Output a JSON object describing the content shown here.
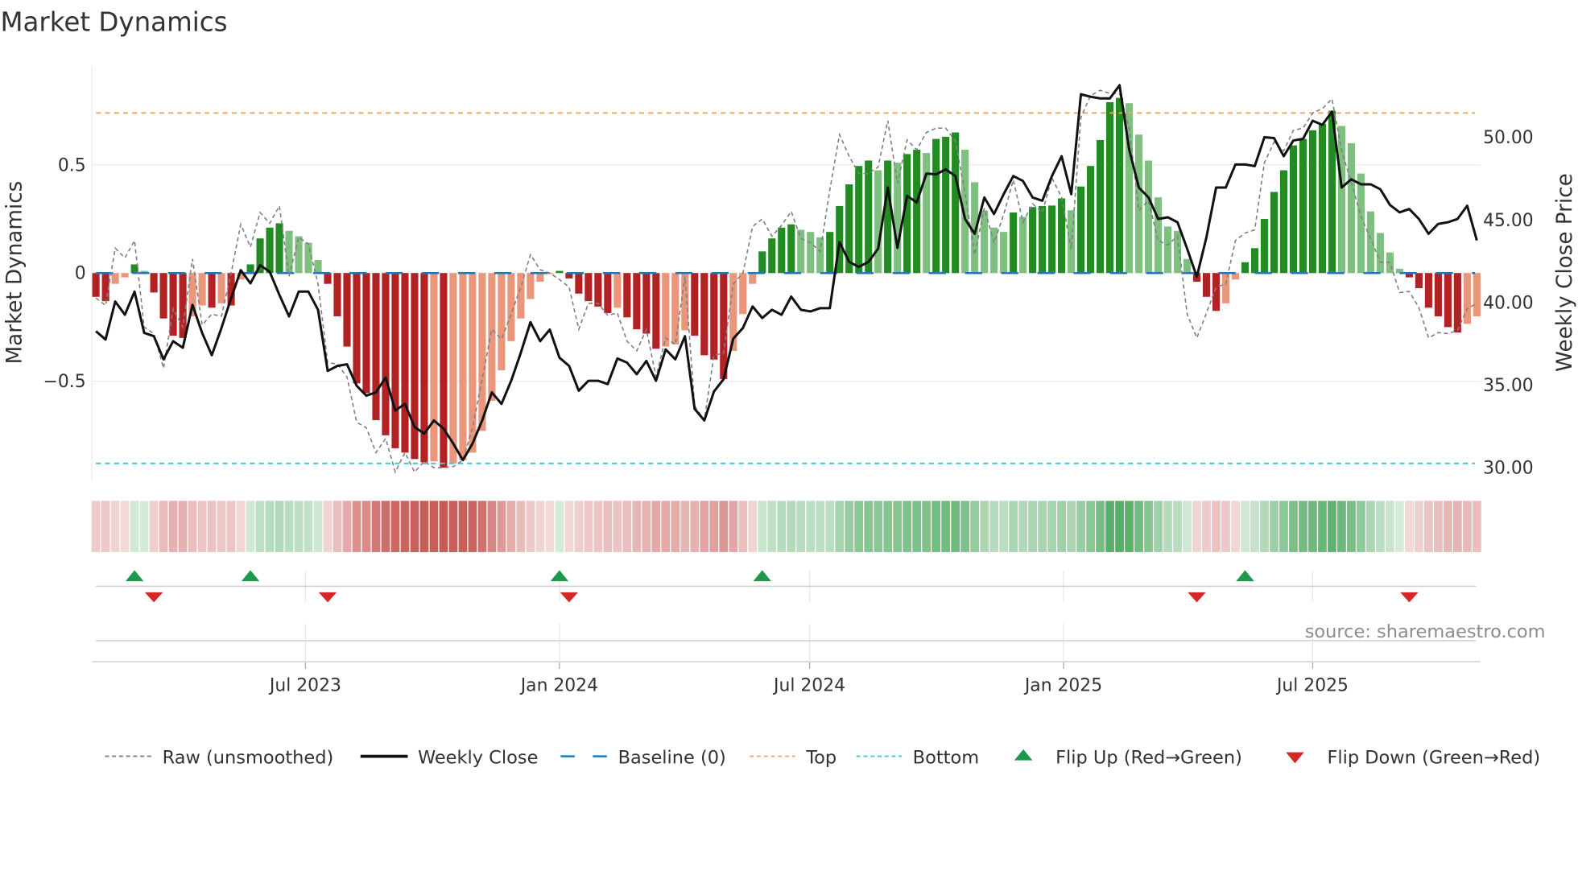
{
  "title": "Market Dynamics",
  "source": "source: sharemaestro.com",
  "colors": {
    "bar_up_strong": "#228b22",
    "bar_up_weak": "#7fbf7f",
    "bar_down_strong": "#b22222",
    "bar_down_weak": "#e9967a",
    "close_line": "#111111",
    "raw_line": "#808080",
    "baseline": "#1f77b4",
    "top": "#f0a868",
    "bottom": "#3cc8dc",
    "flip_up": "#1a9a4a",
    "flip_down": "#d62728",
    "heat_green": "#48a85a",
    "heat_red": "#c85a55"
  },
  "chart_data": {
    "type": "bar",
    "title": "Market Dynamics",
    "xlabel": "",
    "ylabel": "Market Dynamics",
    "ylabel_right": "Weekly Close Price",
    "ylim": [
      -0.96,
      0.96
    ],
    "ylim_right": [
      29.15,
      54.3
    ],
    "yticks": [
      {
        "value": 0.5,
        "label": "0.5"
      },
      {
        "value": 0,
        "label": "0"
      },
      {
        "value": -0.5,
        "label": "−0.5"
      }
    ],
    "yticks_right": [
      {
        "value": 50,
        "label": "50.00"
      },
      {
        "value": 45,
        "label": "45.00"
      },
      {
        "value": 40,
        "label": "40.00"
      },
      {
        "value": 35,
        "label": "35.00"
      },
      {
        "value": 30,
        "label": "30.00"
      }
    ],
    "x_unit": "week index",
    "xticks": [
      {
        "week": 21.7,
        "label": "Jul 2023"
      },
      {
        "week": 48.0,
        "label": "Jan 2024"
      },
      {
        "week": 73.9,
        "label": "Jul 2024"
      },
      {
        "week": 100.2,
        "label": "Jan 2025"
      },
      {
        "week": 126.0,
        "label": "Jul 2025"
      }
    ],
    "thresholds": {
      "top": 0.74,
      "bottom": -0.88,
      "baseline": 0
    },
    "grid": true,
    "legend_position": "bottom",
    "legend": [
      {
        "key": "raw",
        "label": "Raw (unsmoothed)"
      },
      {
        "key": "close",
        "label": "Weekly Close"
      },
      {
        "key": "baseline",
        "label": "Baseline (0)"
      },
      {
        "key": "top",
        "label": "Top"
      },
      {
        "key": "bottom",
        "label": "Bottom"
      },
      {
        "key": "flip_up",
        "label": "Flip Up (Red→Green)"
      },
      {
        "key": "flip_down",
        "label": "Flip Down (Green→Red)"
      }
    ],
    "series": [
      {
        "name": "Market Dynamics (smoothed)",
        "values": [
          -0.11,
          -0.13,
          -0.05,
          -0.02,
          0.04,
          0.01,
          -0.09,
          -0.21,
          -0.29,
          -0.3,
          -0.2,
          -0.15,
          -0.16,
          -0.14,
          -0.15,
          -0.03,
          0.04,
          0.16,
          0.21,
          0.23,
          0.195,
          0.17,
          0.14,
          0.06,
          -0.05,
          -0.2,
          -0.34,
          -0.51,
          -0.555,
          -0.68,
          -0.75,
          -0.81,
          -0.83,
          -0.86,
          -0.875,
          -0.87,
          -0.9,
          -0.88,
          -0.865,
          -0.83,
          -0.73,
          -0.59,
          -0.45,
          -0.315,
          -0.21,
          -0.12,
          -0.04,
          -0.005,
          0.01,
          -0.025,
          -0.095,
          -0.13,
          -0.155,
          -0.185,
          -0.16,
          -0.205,
          -0.26,
          -0.28,
          -0.35,
          -0.34,
          -0.33,
          -0.265,
          -0.29,
          -0.38,
          -0.4,
          -0.49,
          -0.36,
          -0.19,
          -0.05,
          0.1,
          0.16,
          0.21,
          0.225,
          0.2,
          0.19,
          0.165,
          0.19,
          0.31,
          0.41,
          0.495,
          0.52,
          0.475,
          0.52,
          0.51,
          0.55,
          0.57,
          0.555,
          0.62,
          0.63,
          0.65,
          0.57,
          0.42,
          0.29,
          0.21,
          0.19,
          0.28,
          0.26,
          0.305,
          0.31,
          0.312,
          0.345,
          0.29,
          0.4,
          0.495,
          0.615,
          0.79,
          0.81,
          0.785,
          0.64,
          0.52,
          0.35,
          0.215,
          0.195,
          0.065,
          -0.04,
          -0.11,
          -0.175,
          -0.14,
          -0.03,
          0.05,
          0.115,
          0.25,
          0.375,
          0.475,
          0.59,
          0.62,
          0.66,
          0.69,
          0.75,
          0.68,
          0.6,
          0.46,
          0.285,
          0.185,
          0.095,
          0.02,
          -0.02,
          -0.07,
          -0.16,
          -0.2,
          -0.25,
          -0.275,
          -0.235,
          -0.2
        ]
      },
      {
        "name": "Raw (unsmoothed)",
        "values": [
          -0.115,
          -0.15,
          0.115,
          0.07,
          0.15,
          -0.25,
          -0.28,
          -0.44,
          -0.165,
          -0.25,
          0.065,
          -0.24,
          -0.19,
          -0.2,
          0,
          0.225,
          0.12,
          0.28,
          0.23,
          0.31,
          -0.015,
          0.165,
          0.135,
          -0.05,
          -0.415,
          -0.42,
          -0.48,
          -0.69,
          -0.715,
          -0.83,
          -0.765,
          -0.92,
          -0.83,
          -0.92,
          -0.87,
          -0.9,
          -0.9,
          -0.895,
          -0.865,
          -0.715,
          -0.49,
          -0.26,
          -0.305,
          -0.19,
          -0.065,
          0.085,
          0.015,
          0,
          -0.03,
          -0.065,
          -0.26,
          -0.14,
          -0.14,
          -0.195,
          -0.185,
          -0.315,
          -0.36,
          -0.26,
          -0.48,
          -0.3,
          -0.33,
          -0.015,
          -0.615,
          -0.68,
          -0.38,
          -0.37,
          -0.05,
          0,
          0.215,
          0.25,
          0.17,
          0.22,
          0.285,
          0.16,
          0.14,
          0.1,
          0.385,
          0.64,
          0.54,
          0.46,
          0.46,
          0.49,
          0.705,
          0.415,
          0.615,
          0.57,
          0.65,
          0.67,
          0.67,
          0.61,
          0.37,
          0.085,
          0.3,
          0.14,
          0.27,
          0.43,
          0.235,
          0.32,
          0.28,
          0.44,
          0.35,
          0.11,
          0.72,
          0.82,
          0.845,
          0.83,
          0.83,
          0.67,
          0.29,
          0.335,
          0.15,
          0.13,
          0.17,
          -0.19,
          -0.3,
          -0.185,
          -0.065,
          -0.05,
          0.15,
          0.185,
          0.2,
          0.51,
          0.605,
          0.565,
          0.66,
          0.67,
          0.74,
          0.76,
          0.805,
          0.565,
          0.42,
          0.26,
          0.16,
          0.05,
          0.05,
          -0.09,
          -0.085,
          -0.16,
          -0.3,
          -0.275,
          -0.28,
          -0.265,
          -0.165,
          -0.14
        ]
      },
      {
        "name": "Weekly Close",
        "axis": "right",
        "values": [
          38.2,
          37.7,
          40.0,
          39.2,
          40.6,
          38.1,
          37.9,
          36.5,
          37.6,
          37.2,
          39.8,
          38.1,
          36.75,
          38.4,
          40.2,
          41.9,
          41.1,
          42.2,
          41.8,
          40.4,
          39.1,
          40.6,
          40.6,
          39.5,
          35.8,
          36.1,
          36.2,
          34.9,
          34.3,
          34.5,
          35.4,
          33.4,
          33.8,
          32.4,
          32.0,
          32.8,
          32.3,
          31.4,
          30.4,
          31.4,
          32.8,
          34.5,
          33.8,
          35.2,
          36.9,
          38.75,
          37.6,
          38.3,
          36.6,
          36.1,
          34.6,
          35.2,
          35.2,
          35.0,
          36.55,
          36.3,
          35.6,
          36.4,
          35.2,
          37.1,
          36.5,
          37.9,
          33.5,
          32.8,
          34.55,
          35.3,
          37.75,
          38.4,
          39.7,
          39.0,
          39.5,
          39.2,
          40.3,
          39.5,
          39.4,
          39.6,
          39.6,
          43.6,
          42.4,
          42.1,
          42.4,
          43.2,
          46.9,
          43.25,
          46.4,
          46.0,
          47.75,
          47.7,
          48.0,
          47.6,
          45.0,
          44.1,
          46.3,
          45.3,
          46.5,
          47.6,
          47.3,
          46.3,
          46.1,
          47.6,
          48.8,
          46.5,
          52.55,
          52.4,
          52.3,
          52.3,
          53.1,
          49.2,
          46.9,
          46.3,
          45.0,
          45.1,
          44.8,
          43.2,
          41.5,
          43.9,
          46.9,
          46.9,
          48.3,
          48.3,
          48.2,
          49.95,
          49.9,
          48.8,
          49.75,
          49.85,
          50.95,
          50.7,
          51.5,
          46.9,
          47.4,
          47.1,
          47.1,
          46.8,
          45.85,
          45.4,
          45.6,
          45.0,
          44.1,
          44.7,
          44.8,
          45.0,
          45.8,
          43.7
        ]
      }
    ]
  }
}
